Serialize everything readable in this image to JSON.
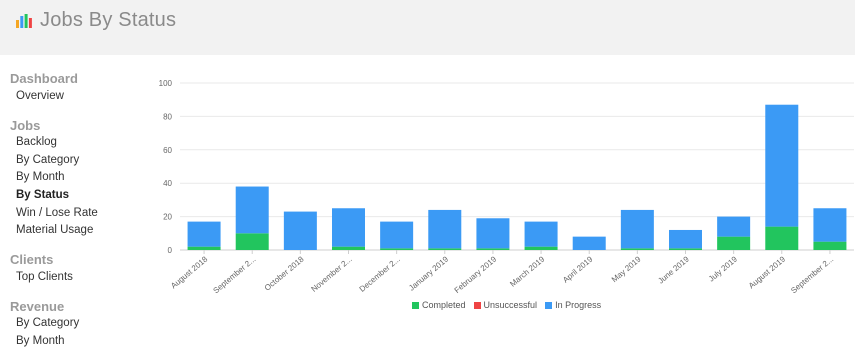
{
  "header": {
    "title": "Jobs By Status"
  },
  "sidebar": {
    "sections": [
      {
        "title": "Dashboard",
        "items": [
          {
            "label": "Overview"
          }
        ]
      },
      {
        "title": "Jobs",
        "items": [
          {
            "label": "Backlog"
          },
          {
            "label": "By Category"
          },
          {
            "label": "By Month"
          },
          {
            "label": "By Status",
            "active": true
          },
          {
            "label": "Win / Lose Rate"
          },
          {
            "label": "Material Usage"
          }
        ]
      },
      {
        "title": "Clients",
        "items": [
          {
            "label": "Top Clients"
          }
        ]
      },
      {
        "title": "Revenue",
        "items": [
          {
            "label": "By Category"
          },
          {
            "label": "By Month"
          }
        ]
      }
    ]
  },
  "chart_data": {
    "type": "bar",
    "stacked": true,
    "categories": [
      "August 2018",
      "September 2...",
      "October 2018",
      "November 2...",
      "December 2...",
      "January 2019",
      "February 2019",
      "March 2019",
      "April 2019",
      "May 2019",
      "June 2019",
      "July 2019",
      "August 2019",
      "September 2..."
    ],
    "series": [
      {
        "name": "Completed",
        "color": "#22c55e",
        "values": [
          2,
          10,
          0,
          2,
          1,
          1,
          1,
          2,
          0,
          1,
          1,
          8,
          14,
          5
        ]
      },
      {
        "name": "Unsuccessful",
        "color": "#ef4444",
        "values": [
          0,
          0,
          0,
          0,
          0,
          0,
          0,
          0,
          0,
          0,
          0,
          0,
          0,
          0
        ]
      },
      {
        "name": "In Progress",
        "color": "#3b9af5",
        "values": [
          15,
          28,
          23,
          23,
          16,
          23,
          18,
          15,
          8,
          23,
          11,
          12,
          73,
          20
        ]
      }
    ],
    "yticks": [
      0,
      20,
      40,
      60,
      80,
      100
    ],
    "ylim": [
      0,
      100
    ],
    "grid": true,
    "legend": "bottom"
  }
}
